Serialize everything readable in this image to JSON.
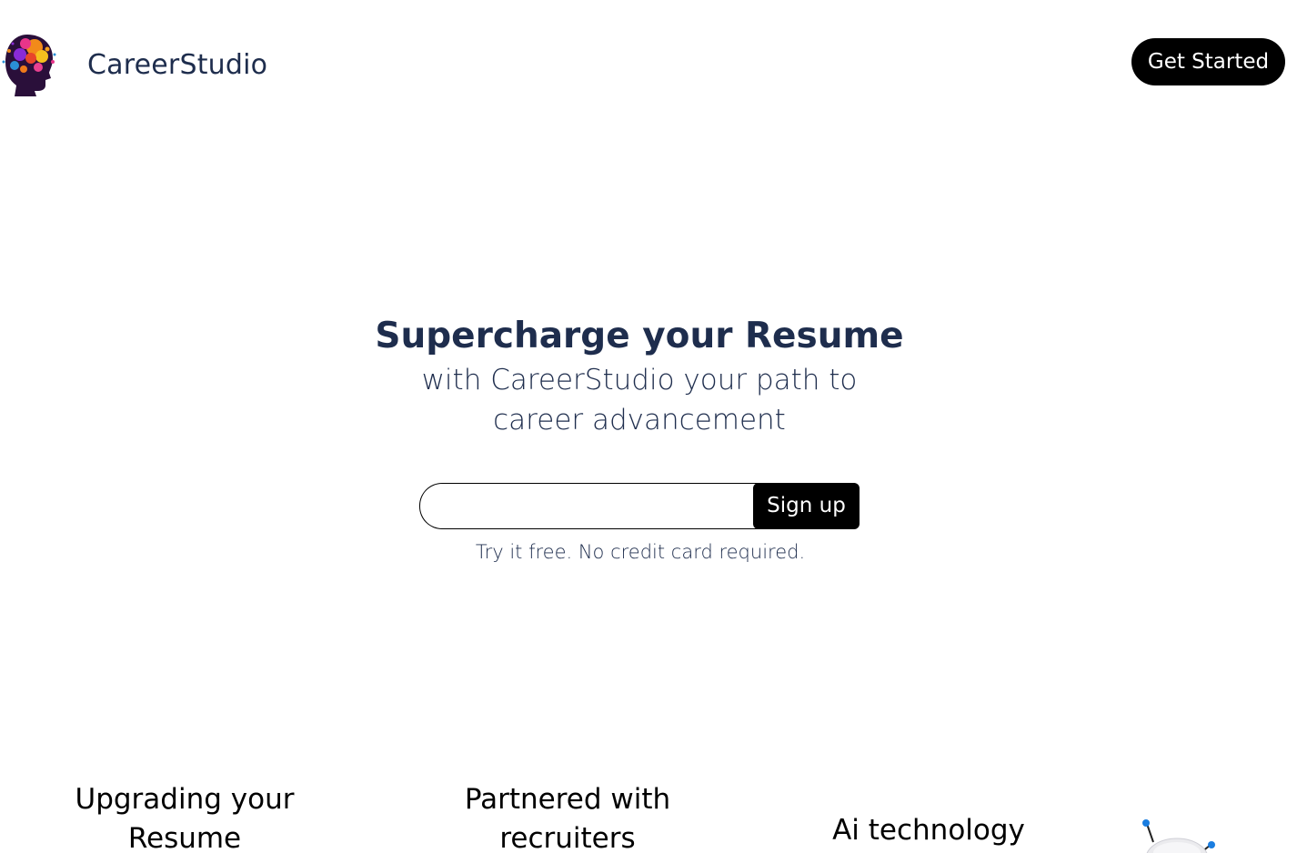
{
  "brand": {
    "logo_icon": "head-silhouette-logo",
    "name": "CareerStudio"
  },
  "header": {
    "cta_label": "Get Started"
  },
  "hero": {
    "title": "Supercharge your Resume",
    "subtitle": "with CareerStudio your path to career advancement"
  },
  "signup": {
    "email_value": "",
    "button_label": "Sign up",
    "note": "Try it free. No credit card required."
  },
  "features": [
    {
      "title": "Upgrading your Resume"
    },
    {
      "title": "Partnered with recruiters"
    },
    {
      "title": "Ai technology",
      "icon": "robot-icon"
    }
  ],
  "colors": {
    "text_primary": "#1e2d4d",
    "button_bg": "#000000",
    "button_text": "#ffffff",
    "robot_accent": "#1a7de0"
  }
}
